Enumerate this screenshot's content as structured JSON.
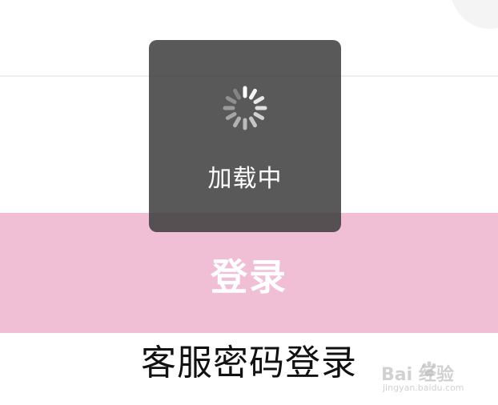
{
  "loading": {
    "text": "加载中",
    "spinner_icon": "spinner-icon"
  },
  "login_button": {
    "label": "登录",
    "color": "#f0bfd6"
  },
  "password_login": {
    "label": "客服密码登录"
  },
  "watermark": {
    "brand": "Bai  经验",
    "url": "jingyan.baidu.com"
  }
}
